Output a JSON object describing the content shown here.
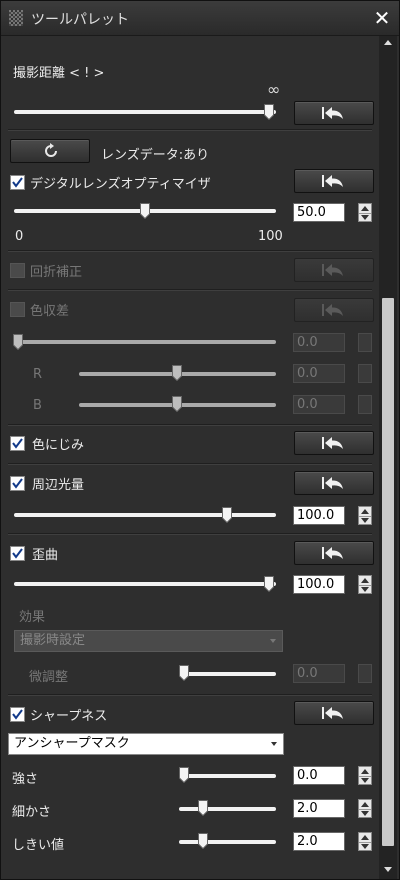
{
  "window": {
    "title": "ツールパレット",
    "close_glyph": "✕"
  },
  "shooting_distance": {
    "label": "撮影距離 < ! >",
    "infinity_symbol": "∞",
    "level": 0.98
  },
  "lens_data": {
    "label": "レンズデータ:あり"
  },
  "dlo": {
    "label": "デジタルレンズオプティマイザ",
    "checked": true,
    "value": "50.0",
    "min_label": "0",
    "max_label": "100",
    "level": 0.5
  },
  "diffraction": {
    "label": "回折補正",
    "checked": false,
    "enabled": false
  },
  "chromatic": {
    "label": "色収差",
    "checked": false,
    "enabled": false,
    "value": "0.0",
    "r_label": "R",
    "r_value": "0.0",
    "b_label": "B",
    "b_value": "0.0",
    "level": 0.0,
    "r_level": 0.5,
    "b_level": 0.5
  },
  "color_blur": {
    "label": "色にじみ",
    "checked": true
  },
  "peripheral": {
    "label": "周辺光量",
    "checked": true,
    "value": "100.0",
    "level": 0.82
  },
  "distortion": {
    "label": "歪曲",
    "checked": true,
    "value": "100.0",
    "level": 1.0,
    "effect_label": "効果",
    "effect_select": "撮影時設定",
    "fine_label": "微調整",
    "fine_value": "0.0",
    "fine_level": 0.05
  },
  "sharpness": {
    "label": "シャープネス",
    "checked": true,
    "mode_select": "アンシャープマスク",
    "strength_label": "強さ",
    "strength_value": "0.0",
    "strength_level": 0.05,
    "fineness_label": "細かさ",
    "fineness_value": "2.0",
    "fineness_level": 0.25,
    "threshold_label": "しきい値",
    "threshold_value": "2.0",
    "threshold_level": 0.25
  },
  "colors": {
    "panel": "#2e2e2e",
    "button": "#3d3d3d",
    "scroll_thumb": "#c9c9c9"
  }
}
